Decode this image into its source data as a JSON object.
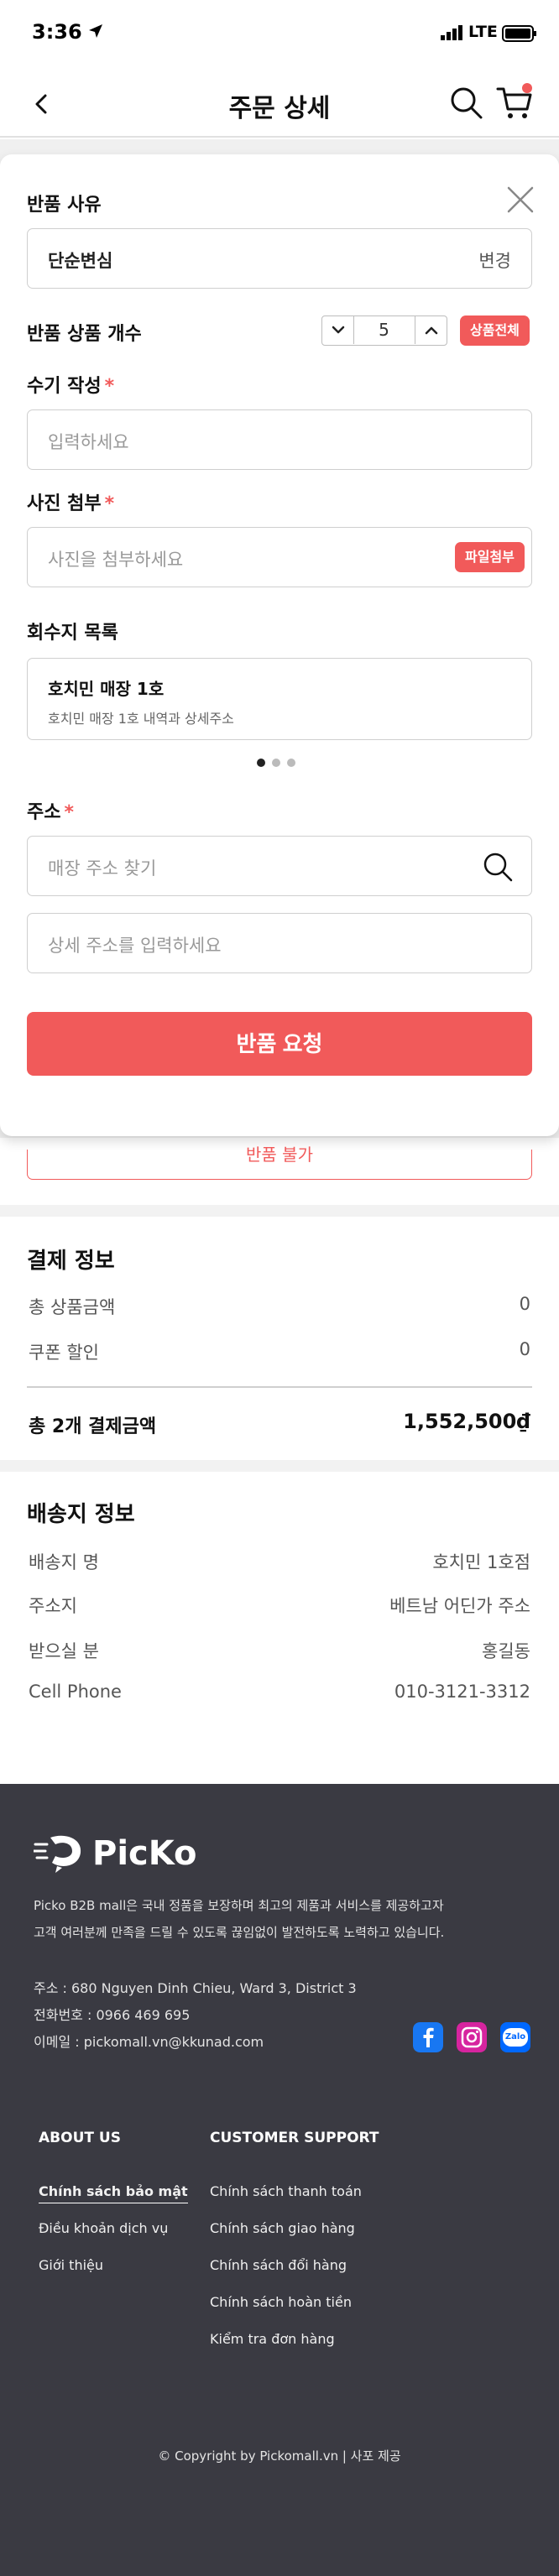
{
  "status_bar": {
    "time": "3:36",
    "network": "LTE"
  },
  "header": {
    "title": "주문 상세"
  },
  "modal": {
    "reason": {
      "label": "반품 사유",
      "value": "단순변심",
      "change_label": "변경"
    },
    "quantity": {
      "label": "반품 상품 개수",
      "value": "5",
      "all_label": "상품전체"
    },
    "manual": {
      "label": "수기 작성",
      "required_mark": "*",
      "placeholder": "입력하세요"
    },
    "photo": {
      "label": "사진 첨부",
      "required_mark": "*",
      "placeholder": "사진을 첨부하세요",
      "attach_label": "파일첨부"
    },
    "collection": {
      "label": "회수지 목록",
      "name": "호치민 매장 1호",
      "detail": "호치민 매장 1호 내역과 상세주소",
      "pages": 3,
      "active_page": 1
    },
    "address": {
      "label": "주소",
      "required_mark": "*",
      "search_placeholder": "매장 주소 찾기",
      "detail_placeholder": "상세 주소를 입력하세요"
    },
    "submit_label": "반품 요청"
  },
  "refund_unavailable": "반품 불가",
  "payment": {
    "title": "결제 정보",
    "rows": [
      {
        "label": "총 상품금액",
        "value": "0"
      },
      {
        "label": "쿠폰 할인",
        "value": "0"
      }
    ],
    "total_label": "총 2개 결제금액",
    "total_value": "1,552,500₫"
  },
  "shipping": {
    "title": "배송지 정보",
    "rows": [
      {
        "label": "배송지 명",
        "value": "호치민 1호점"
      },
      {
        "label": "주소지",
        "value": "베트남 어딘가 주소"
      },
      {
        "label": "받으실 분",
        "value": "홍길동"
      },
      {
        "label": "Cell Phone",
        "value": "010-3121-3312"
      }
    ]
  },
  "footer": {
    "brand": "PicKo",
    "desc_line1": "Picko B2B mall은 국내 정품을 보장하며 최고의 제품과 서비스를 제공하고자",
    "desc_line2": "고객 여러분께 만족을 드릴 수 있도록 끊임없이 발전하도록 노력하고 있습니다.",
    "address": "주소 : 680 Nguyen Dinh Chieu, Ward 3, District 3",
    "phone": "전화번호 : 0966 469 695",
    "email": "이메일 : pickomall.vn@kkunad.com",
    "social": [
      "facebook-icon",
      "instagram-icon",
      "zalo-icon"
    ],
    "zalo_text": "Zalo",
    "about": {
      "heading": "ABOUT US",
      "links": [
        "Chính sách bảo mật",
        "Điều khoản dịch vụ",
        "Giới thiệu"
      ]
    },
    "support": {
      "heading": "CUSTOMER SUPPORT",
      "links": [
        "Chính sách thanh toán",
        "Chính sách giao hàng",
        "Chính sách đổi hàng",
        "Chính sách hoàn tiền",
        "Kiểm tra đơn hàng"
      ]
    },
    "copyright": "© Copyright by Pickomall.vn | 사포 제공"
  },
  "colors": {
    "accent": "#f15a5a",
    "footer_bg": "#3a3a42"
  }
}
